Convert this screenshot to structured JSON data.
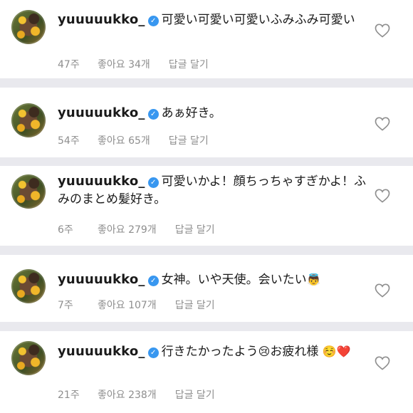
{
  "colors": {
    "background": "#e9e9ee",
    "card": "#ffffff",
    "verified": "#3897f0",
    "meta": "#8e8e8e"
  },
  "icons": {
    "verified": "verified-badge-icon",
    "like": "heart-outline-icon"
  },
  "comments": [
    {
      "username": "yuuuuukko_",
      "text": "可愛い可愛い可愛いふみふみ可愛い",
      "age": "47주",
      "likes": "좋아요 34개",
      "reply": "답글 달기"
    },
    {
      "username": "yuuuuukko_",
      "text": "あぁ好き。",
      "age": "54주",
      "likes": "좋아요 65개",
      "reply": "답글 달기"
    },
    {
      "username": "yuuuuukko_",
      "text": "可愛いかよ！顔ちっちゃすぎかよ！ふみのまとめ髪好き。",
      "age": "6주",
      "likes": "좋아요 279개",
      "reply": "답글 달기"
    },
    {
      "username": "yuuuuukko_",
      "text": "女神。いや天使。会いたい",
      "emoji": "👼",
      "age": "7주",
      "likes": "좋아요 107개",
      "reply": "답글 달기"
    },
    {
      "username": "yuuuuukko_",
      "text": "行きたかったよう",
      "emoji": "😢",
      "text2": "お疲れ様",
      "emoji2": "☺️❤️",
      "age": "21주",
      "likes": "좋아요 238개",
      "reply": "답글 달기"
    }
  ]
}
